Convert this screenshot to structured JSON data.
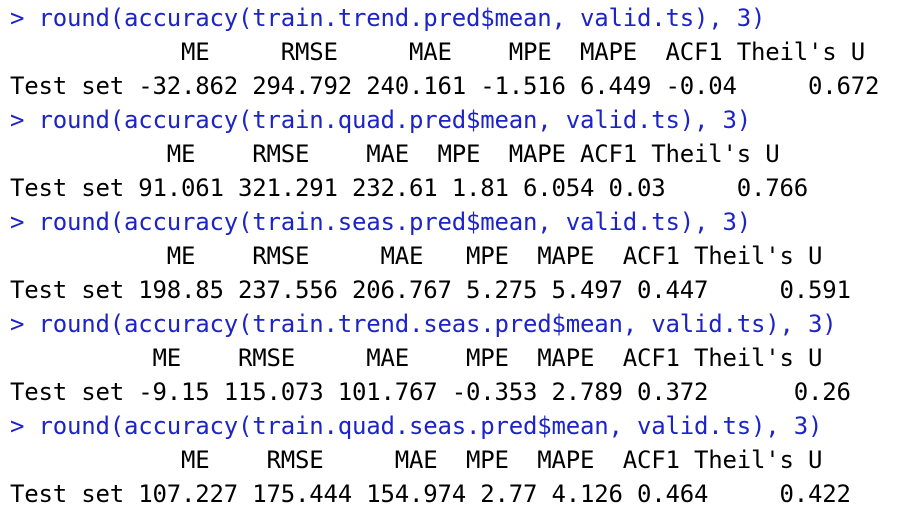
{
  "console": {
    "blocks": [
      {
        "prompt": "> ",
        "command": "round(accuracy(train.trend.pred$mean, valid.ts), 3)",
        "header": "            ME     RMSE     MAE    MPE  MAPE  ACF1 Theil's U",
        "row": "Test set -32.862 294.792 240.161 -1.516 6.449 -0.04     0.672"
      },
      {
        "prompt": "> ",
        "command": "round(accuracy(train.quad.pred$mean, valid.ts), 3)",
        "header": "           ME    RMSE    MAE  MPE  MAPE ACF1 Theil's U",
        "row": "Test set 91.061 321.291 232.61 1.81 6.054 0.03     0.766"
      },
      {
        "prompt": "> ",
        "command": "round(accuracy(train.seas.pred$mean, valid.ts), 3)",
        "header": "           ME    RMSE     MAE   MPE  MAPE  ACF1 Theil's U",
        "row": "Test set 198.85 237.556 206.767 5.275 5.497 0.447     0.591"
      },
      {
        "prompt": "> ",
        "command": "round(accuracy(train.trend.seas.pred$mean, valid.ts), 3)",
        "header": "          ME    RMSE     MAE    MPE  MAPE  ACF1 Theil's U",
        "row": "Test set -9.15 115.073 101.767 -0.353 2.789 0.372      0.26"
      },
      {
        "prompt": "> ",
        "command": "round(accuracy(train.quad.seas.pred$mean, valid.ts), 3)",
        "header": "            ME    RMSE     MAE  MPE  MAPE  ACF1 Theil's U",
        "row": "Test set 107.227 175.444 154.974 2.77 4.126 0.464     0.422"
      }
    ]
  },
  "colors": {
    "command": "#1d24c7",
    "output": "#000000",
    "background": "#ffffff"
  }
}
